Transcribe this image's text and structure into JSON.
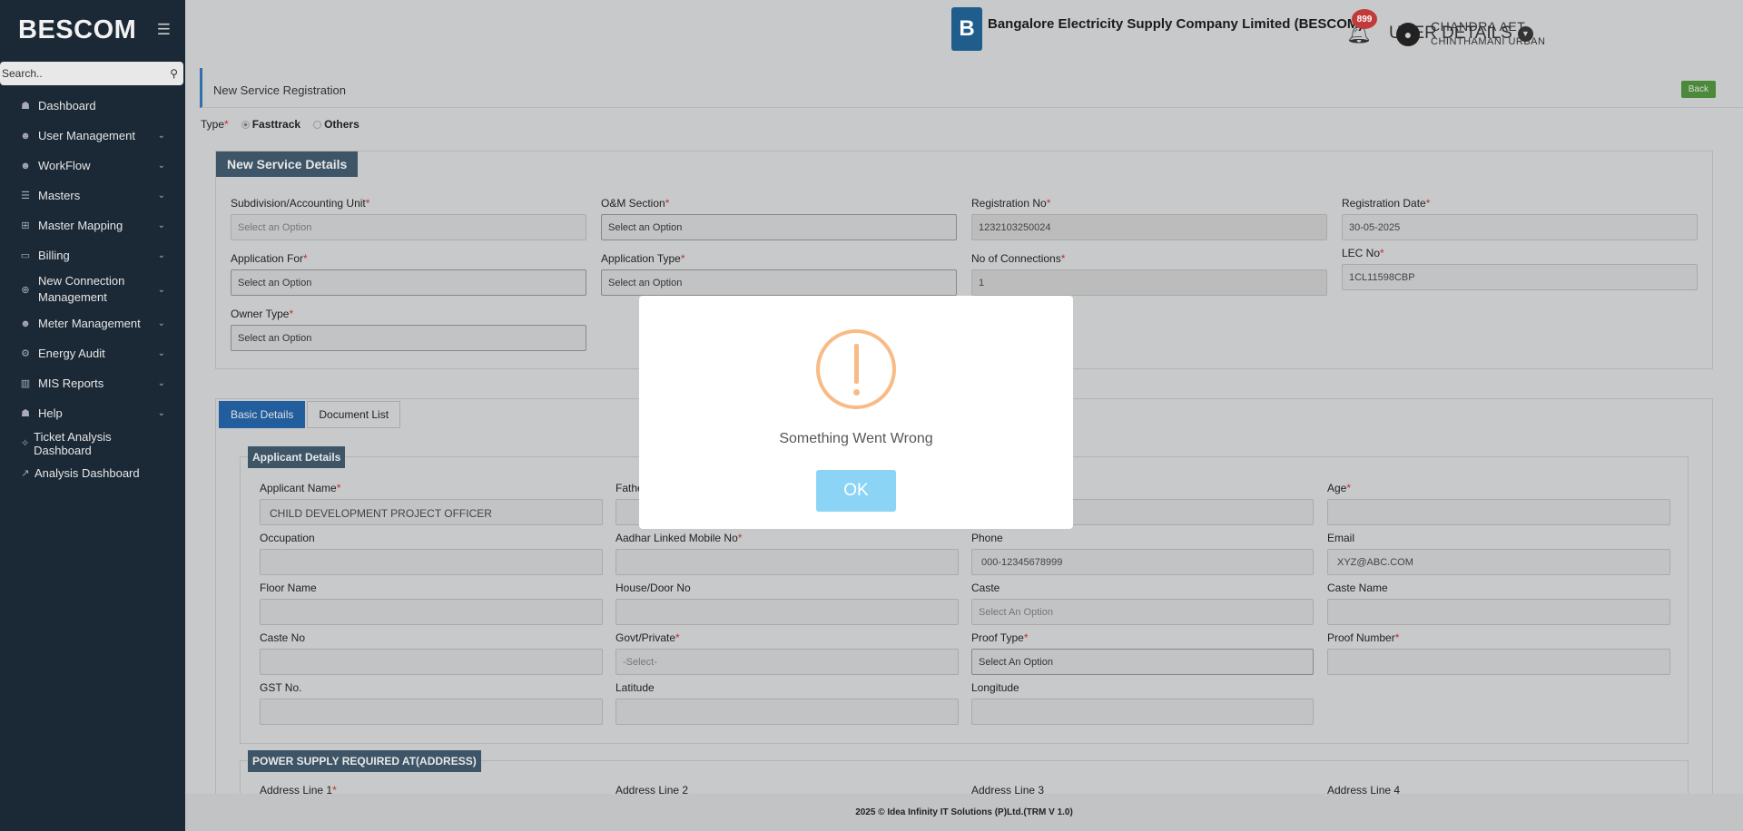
{
  "sidebar": {
    "brand": "BESCOM",
    "search_placeholder": "Search..",
    "items": [
      {
        "label": "Dashboard",
        "icon": "dashboard-icon",
        "glyph": "☗",
        "chevron": false
      },
      {
        "label": "User Management",
        "icon": "user-icon",
        "glyph": "☻",
        "chevron": true
      },
      {
        "label": "WorkFlow",
        "icon": "user-icon",
        "glyph": "☻",
        "chevron": true
      },
      {
        "label": "Masters",
        "icon": "list-icon",
        "glyph": "☰",
        "chevron": true
      },
      {
        "label": "Master Mapping",
        "icon": "sitemap-icon",
        "glyph": "⊞",
        "chevron": true
      },
      {
        "label": "Billing",
        "icon": "desktop-icon",
        "glyph": "▭",
        "chevron": true
      },
      {
        "label": "New Connection Management",
        "icon": "plug-icon",
        "glyph": "⊕",
        "chevron": true
      },
      {
        "label": "Meter Management",
        "icon": "user-icon",
        "glyph": "☻",
        "chevron": true
      },
      {
        "label": "Energy Audit",
        "icon": "cogs-icon",
        "glyph": "⚙",
        "chevron": true
      },
      {
        "label": "MIS Reports",
        "icon": "bar-chart-icon",
        "glyph": "▥",
        "chevron": true
      },
      {
        "label": "Help",
        "icon": "help-icon",
        "glyph": "☗",
        "chevron": true
      },
      {
        "label": "Ticket Analysis Dashboard",
        "icon": "ticket-icon",
        "glyph": "✧",
        "chevron": false
      },
      {
        "label": "Analysis Dashboard",
        "icon": "line-chart-icon",
        "glyph": "↗",
        "chevron": false
      }
    ]
  },
  "header": {
    "company": "Bangalore Electricity Supply Company Limited (BESCOM)",
    "user_details": "USER DETAILS",
    "notifications_count": "899",
    "user_name": "CHANDRA AET",
    "user_location": "CHINTHAMANI URBAN"
  },
  "page": {
    "title": "New Service Registration",
    "back": "Back",
    "type_label": "Type",
    "type_options": [
      "Fasttrack",
      "Others"
    ],
    "type_selected": "Fasttrack"
  },
  "service": {
    "heading": "New Service Details",
    "subdivision_label": "Subdivision/Accounting Unit",
    "subdivision_value": "Select an Option",
    "om_label": "O&M Section",
    "om_value": "Select an Option",
    "regno_label": "Registration No",
    "regno_value": "1232103250024",
    "regdate_label": "Registration Date",
    "regdate_value": "30-05-2025",
    "appfor_label": "Application For",
    "appfor_value": "Select an Option",
    "apptype_label": "Application Type",
    "apptype_value": "Select an Option",
    "conns_label": "No of Connections",
    "conns_value": "1",
    "lec_label": "LEC No",
    "lec_value": "1CL11598CBP",
    "owner_label": "Owner Type",
    "owner_value": "Select an Option"
  },
  "tabs": [
    "Basic Details",
    "Document List"
  ],
  "applicant": {
    "heading": "Applicant Details",
    "name_label": "Applicant Name",
    "name_value": "CHILD DEVELOPMENT PROJECT OFFICER",
    "father_label": "Fathe",
    "age_label": "Age",
    "occupation_label": "Occupation",
    "aadhar_label": "Aadhar Linked Mobile No",
    "phone_label": "Phone",
    "phone_value": "000-12345678999",
    "email_label": "Email",
    "email_value": "XYZ@ABC.COM",
    "floor_label": "Floor Name",
    "house_label": "House/Door No",
    "caste_label": "Caste",
    "caste_value": "Select An Option",
    "castename_label": "Caste Name",
    "casteno_label": "Caste No",
    "govt_label": "Govt/Private",
    "govt_value": "-Select-",
    "proof_label": "Proof Type",
    "proof_value": "Select An Option",
    "proofno_label": "Proof Number",
    "gst_label": "GST No.",
    "lat_label": "Latitude",
    "long_label": "Longitude"
  },
  "address": {
    "heading": "POWER SUPPLY REQUIRED AT(ADDRESS)",
    "line1": "Address Line 1",
    "line2": "Address Line 2",
    "line3": "Address Line 3",
    "line4": "Address Line 4"
  },
  "footer": "2025 © Idea Infinity IT Solutions (P)Ltd.(TRM V 1.0)",
  "modal": {
    "message": "Something Went Wrong",
    "ok": "OK",
    "icon": "warning-icon"
  },
  "colors": {
    "sidebar_bg": "#1b2936",
    "accent_blue": "#225d9e",
    "back_green": "#4a8a3a",
    "warning": "#f8bb86",
    "ok_button": "#8cd4f5",
    "badge_red": "#c23a3a"
  }
}
